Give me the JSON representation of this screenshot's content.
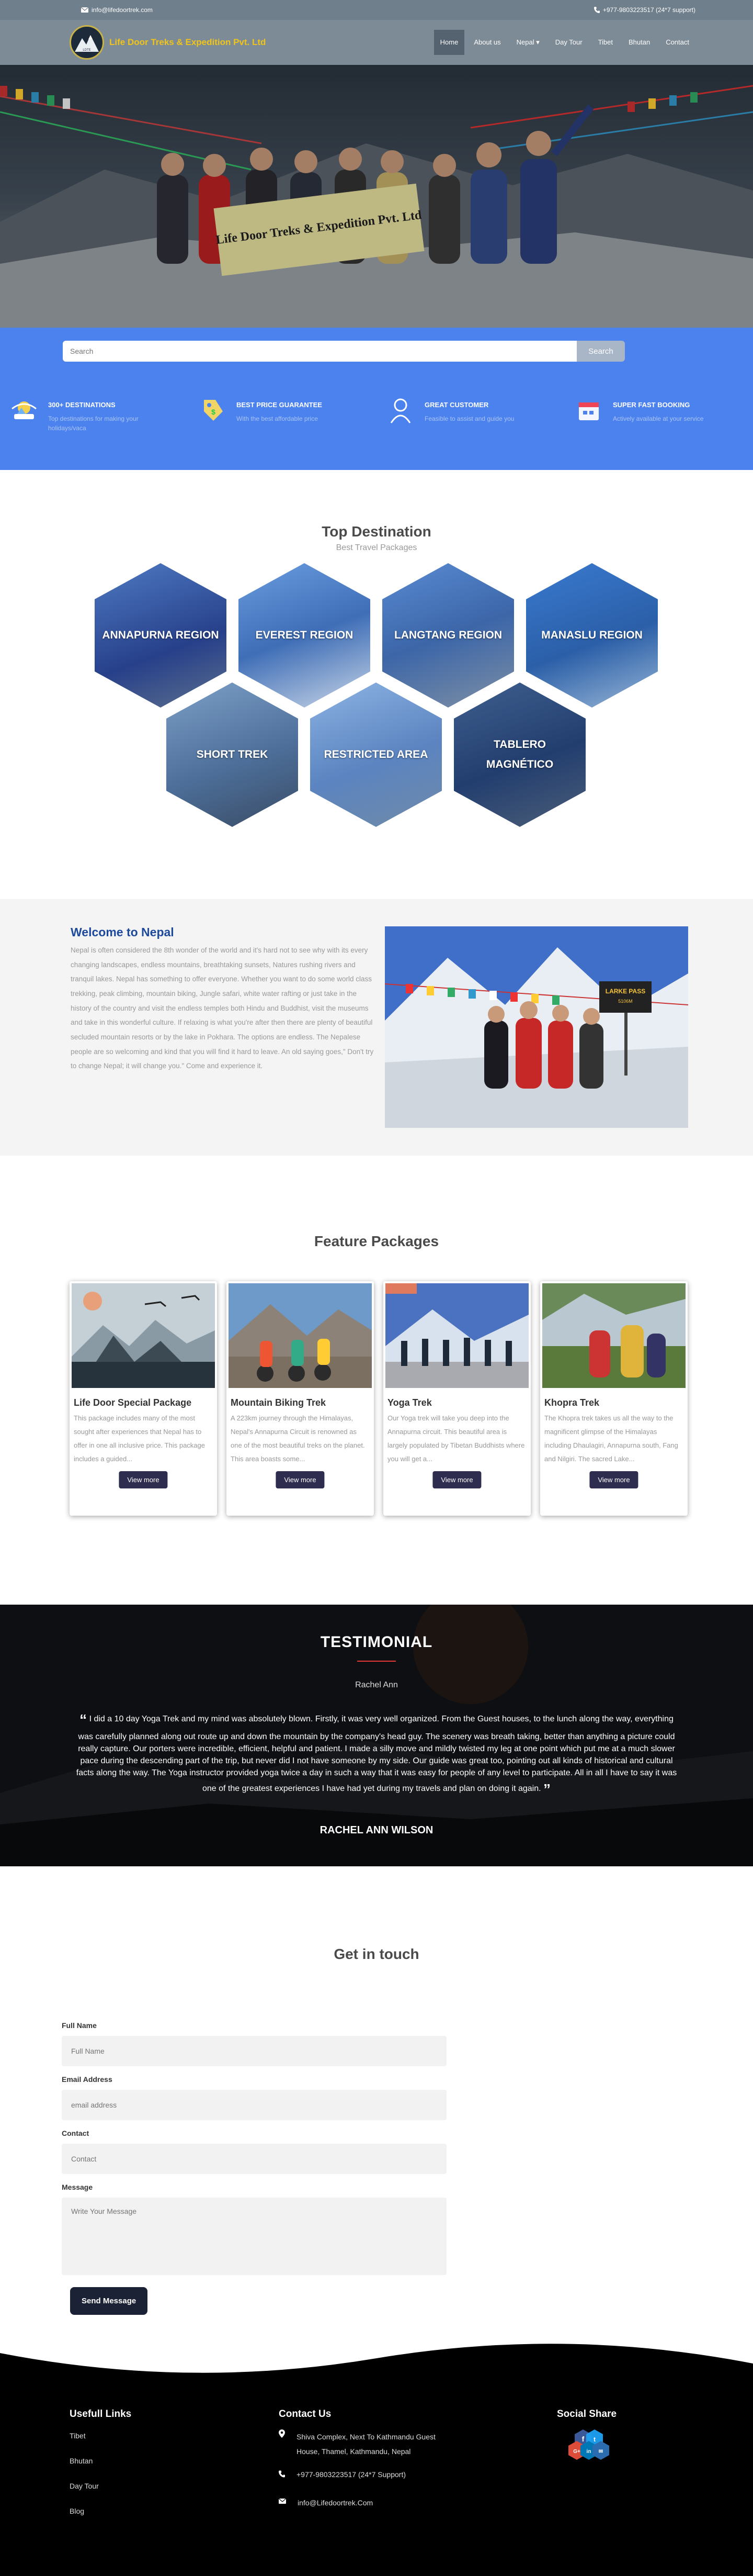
{
  "topbar": {
    "email": "info@lifedoortrek.com",
    "phone": "+977-9803223517 (24*7 support)"
  },
  "nav": {
    "brand": "Life Door Treks & Expedition Pvt. Ltd",
    "items": [
      "Home",
      "About us",
      "Nepal ▾",
      "Day Tour",
      "Tibet",
      "Bhutan",
      "Contact"
    ]
  },
  "search": {
    "placeholder": "Search",
    "button": "Search"
  },
  "features": [
    {
      "title": "300+ DESTINATIONS",
      "text": "Top destinations for making your holidays/vaca",
      "icon": "destinations-icon"
    },
    {
      "title": "BEST PRICE GUARANTEE",
      "text": "With the best affordable price",
      "icon": "price-tag-icon"
    },
    {
      "title": "GREAT CUSTOMER",
      "text": "Feasible to assist and guide you",
      "icon": "customer-icon"
    },
    {
      "title": "SUPER FAST BOOKING",
      "text": "Actively available at your service",
      "icon": "booking-icon"
    }
  ],
  "destinations": {
    "title": "Top Destination",
    "subtitle": "Best Travel Packages",
    "items": [
      "ANNAPURNA REGION",
      "EVEREST REGION",
      "LANGTANG REGION",
      "MANASLU REGION",
      "SHORT TREK",
      "RESTRICTED AREA",
      "TABLERO MAGNÉTICO"
    ]
  },
  "welcome": {
    "title": "Welcome to Nepal",
    "text": "Nepal is often considered the 8th wonder of the world and it's hard not to see why with its every changing landscapes, endless mountains, breathtaking sunsets, Natures rushing rivers and tranquil lakes. Nepal has something to offer everyone. Whether you want to do some world class trekking, peak climbing, mountain biking, Jungle safari, white water rafting or just take in the history of the country and visit the endless temples both Hindu and Buddhist, visit the museums and take in this wonderful culture. If relaxing is what you're after then there are plenty of beautiful secluded mountain resorts or by the lake in Pokhara. The options are endless. The Nepalese people are so welcoming and kind that you will find it hard to leave. An old saying goes,\" Don't try to change Nepal; it will change you.\" Come and experience it."
  },
  "packages": {
    "title": "Feature Packages",
    "items": [
      {
        "name": "Life Door Special Package",
        "desc": "This package includes many of the most sought after experiences that Nepal has to offer in one all inclusive price. This package includes a guided...",
        "button": "View more"
      },
      {
        "name": "Mountain Biking Trek",
        "desc": "A 223km journey through the Himalayas, Nepal's Annapurna Circuit is renowned as one of the most beautiful treks on the planet. This area boasts some...",
        "button": "View more"
      },
      {
        "name": "Yoga Trek",
        "desc": "Our Yoga trek will take you deep into the Annapurna circuit. This beautiful area is largely populated by Tibetan Buddhists where you will get a...",
        "button": "View more"
      },
      {
        "name": "Khopra Trek",
        "desc": "The Khopra trek takes us all the way to the magnificent glimpse of the Himalayas including Dhaulagiri, Annapurna south, Fang and Nilgiri. The sacred Lake...",
        "button": "View more"
      }
    ]
  },
  "testimonial": {
    "title": "TESTIMONIAL",
    "photo_alt": "Rachel Ann",
    "quote": "I did a 10 day Yoga Trek and my mind was absolutely blown. Firstly, it was very well organized. From the Guest houses, to the lunch along the way, everything was carefully planned along out route up and down the mountain by the company's head guy. The scenery was breath taking, better than anything a picture could really capture. Our porters were incredible, efficient, helpful and patient. I made a silly move and mildly twisted my leg at one point which put me at a much slower pace during the descending part of the trip, but never did I not have someone by my side. Our guide was great too, pointing out all kinds of historical and cultural facts along the way. The Yoga instructor provided yoga twice a day in such a way that it was easy for people of any level to participate. All in all I have to say it was one of the greatest experiences I have had yet during my travels and plan on doing it again.",
    "author": "RACHEL ANN WILSON"
  },
  "contact": {
    "title": "Get in touch",
    "fields": [
      {
        "label": "Full Name",
        "placeholder": "Full Name"
      },
      {
        "label": "Email Address",
        "placeholder": "email address"
      },
      {
        "label": "Contact",
        "placeholder": "Contact"
      },
      {
        "label": "Message",
        "placeholder": "Write Your Message"
      }
    ],
    "button": "Send Message"
  },
  "footer": {
    "links_title": "Usefull Links",
    "links": [
      "Tibet",
      "Bhutan",
      "Day Tour",
      "Blog"
    ],
    "contact_title": "Contact Us",
    "address": "Shiva Complex, Next To Kathmandu Guest House, Thamel, Kathmandu, Nepal",
    "phone": "+977-9803223517 (24*7 Support)",
    "email": "info@Lifedoortrek.Com",
    "social_title": "Social Share"
  }
}
